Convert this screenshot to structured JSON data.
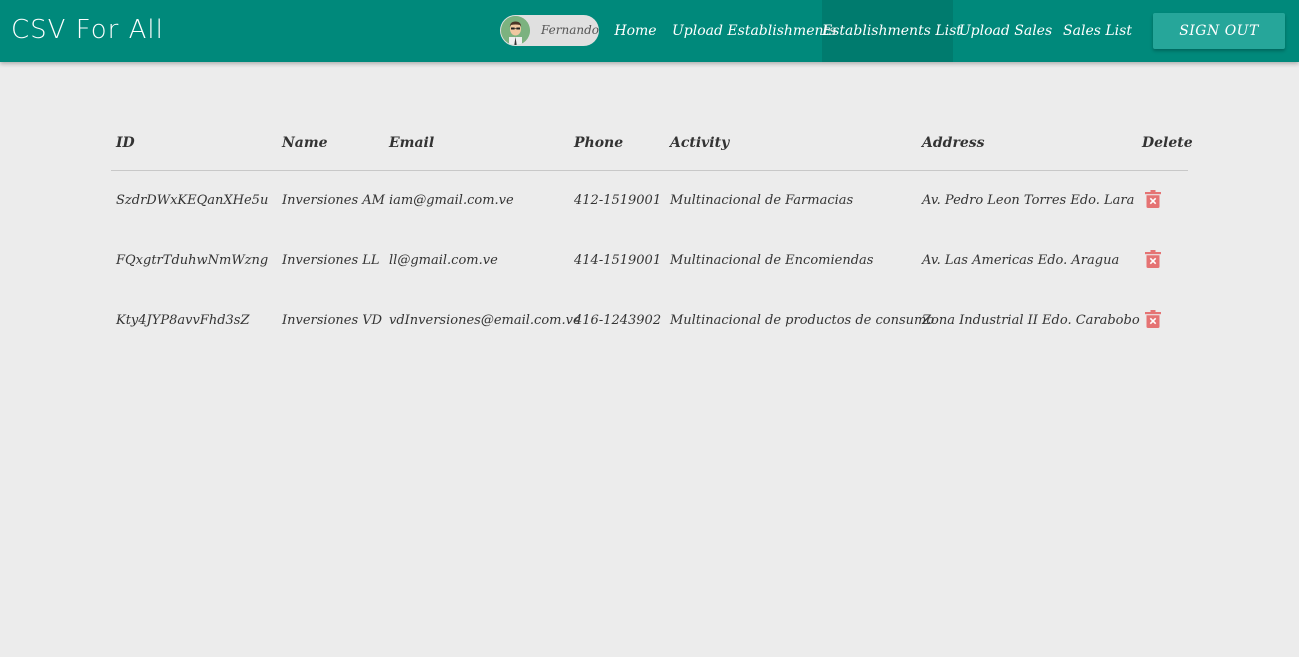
{
  "app": {
    "brand": "CSV For All"
  },
  "user": {
    "name": "Fernando"
  },
  "nav": {
    "home": "Home",
    "upload_establishments": "Upload Establishments",
    "establishments_list": "Establishments List",
    "upload_sales": "Upload Sales",
    "sales_list": "Sales List",
    "active": "establishments_list"
  },
  "actions": {
    "sign_out": "SIGN OUT"
  },
  "colors": {
    "primary": "#00897b",
    "button": "#26a69a",
    "delete": "#e57373",
    "background": "#ececec"
  },
  "table": {
    "headers": {
      "id": "ID",
      "name": "Name",
      "email": "Email",
      "phone": "Phone",
      "activity": "Activity",
      "address": "Address",
      "delete": "Delete"
    },
    "rows": [
      {
        "id": "SzdrDWxKEQanXHe5u",
        "name": "Inversiones AM",
        "email": "iam@gmail.com.ve",
        "phone": "412-1519001",
        "activity": "Multinacional de Farmacias",
        "address": "Av. Pedro Leon Torres Edo. Lara",
        "delete_icon": "delete-forever-icon"
      },
      {
        "id": "FQxgtrTduhwNmWzng",
        "name": "Inversiones LL",
        "email": "ll@gmail.com.ve",
        "phone": "414-1519001",
        "activity": "Multinacional de Encomiendas",
        "address": "Av. Las Americas Edo. Aragua",
        "delete_icon": "delete-forever-icon"
      },
      {
        "id": "Kty4JYP8avvFhd3sZ",
        "name": "Inversiones VD",
        "email": "vdInversiones@email.com.ve",
        "phone": "416-1243902",
        "activity": "Multinacional de productos de consumo",
        "address": "Zona Industrial II Edo. Carabobo",
        "delete_icon": "delete-forever-icon"
      }
    ]
  }
}
